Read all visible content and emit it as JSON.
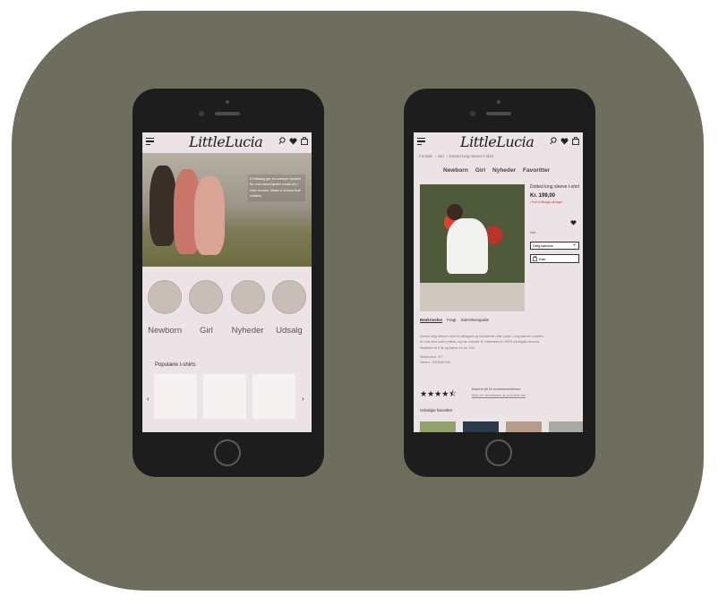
{
  "brand": {
    "logo": "LittleLucia"
  },
  "home": {
    "hero_text": "Et tidsløg ger en kæmpe forskel for vnd barnehjerter rundt om i hele verden. Make a choice that matters",
    "categories": [
      {
        "label": "Newborn"
      },
      {
        "label": "Girl"
      },
      {
        "label": "Nyheder"
      },
      {
        "label": "Udsalg"
      }
    ],
    "section_title": "Populære t-shirts",
    "arrow_left": "‹",
    "arrow_right": "›"
  },
  "product_page": {
    "breadcrumb": [
      "Forside",
      "Girl",
      "Dotted long sleeve t-shirt"
    ],
    "nav": [
      "Newborn",
      "Girl",
      "Nyheder",
      "Favoritter"
    ],
    "title": "Dotted long sleeve t-shirt",
    "price": "Kr. 199,00",
    "stock_note": "• Kun 6 tilbage på lager",
    "size_label": "Køb",
    "size_select": "Vælg størrelse",
    "cart_button": "Køb",
    "tabs": [
      "Beskrivelse",
      "Fragt",
      "Størrelsesguide"
    ],
    "desc_1": "Denne long sleeve t-shirt er designet og udviklet af Little Lucia. Long sleeve t-shirten er hvid med sorte prikker, og har onesize fit. Materialet er 100% økologisk bomuld. Modellen er 4 år og bærer en str. 104.",
    "desc_2": "Modelnavn: 4T°",
    "desc_3": "Varenr.: 2975487932",
    "rating_stars": "★★★★⯪",
    "rating_summary": "Baseret på 54 kundeanmeldelser",
    "rating_link": "Skriv en anmeldelse af produktet her",
    "favorites_title": "Udvalgte favoritter"
  }
}
